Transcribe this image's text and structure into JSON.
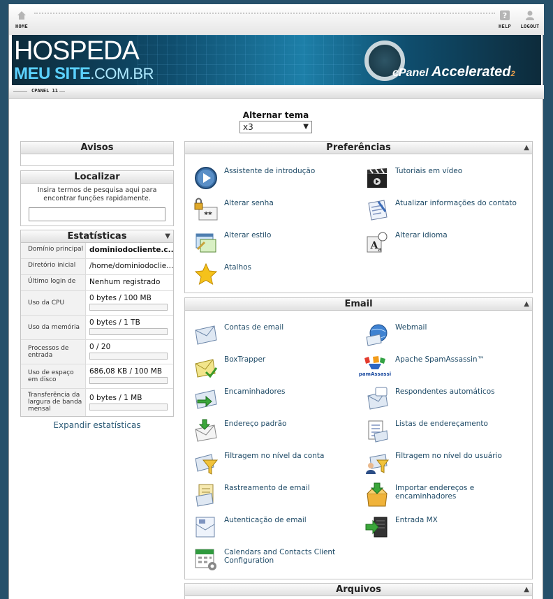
{
  "topbar": {
    "home": "HOME",
    "help": "HELP",
    "logout": "LOGOUT"
  },
  "banner": {
    "line1": "HOSPEDA",
    "line2a": "MEU SITE",
    "line2b": ".COM.BR",
    "brand": "cPanel",
    "brand_suffix": "Accelerated",
    "brand_version": "2"
  },
  "breadcrumb": "CPANEL 11",
  "theme": {
    "label": "Alternar tema",
    "selected": "x3"
  },
  "avisos": {
    "title": "Avisos"
  },
  "localizar": {
    "title": "Localizar",
    "description": "Insira termos de pesquisa aqui para encontrar funções rapidamente.",
    "value": ""
  },
  "stats": {
    "title": "Estatísticas",
    "rows": [
      {
        "label": "Domínio principal",
        "value": "dominiodocliente.c..."
      },
      {
        "label": "Diretório inicial",
        "value": "/home/dominiodoclie..."
      },
      {
        "label": "Último login de",
        "value": "Nenhum registrado"
      },
      {
        "label": "Uso da CPU",
        "value": "0 bytes / 100 MB",
        "fill": 0
      },
      {
        "label": "Uso da memória",
        "value": "0 bytes / 1 TB",
        "fill": 0
      },
      {
        "label": "Processos de entrada",
        "value": "0 / 20",
        "fill": 0
      },
      {
        "label": "Uso de espaço em disco",
        "value": "686,08 KB / 100 MB",
        "fill": 0
      },
      {
        "label": "Transferência da largura de banda mensal",
        "value": "0 bytes / 1 MB",
        "fill": 0
      }
    ],
    "expand": "Expandir estatísticas"
  },
  "preferencias": {
    "title": "Preferências",
    "items": [
      "Assistente de introdução",
      "Tutoriais em vídeo",
      "Alterar senha",
      "Atualizar informações do contato",
      "Alterar estilo",
      "Alterar idioma",
      "Atalhos"
    ]
  },
  "email": {
    "title": "Email",
    "items": [
      "Contas de email",
      "Webmail",
      "BoxTrapper",
      "Apache SpamAssassin™",
      "Encaminhadores",
      "Respondentes automáticos",
      "Endereço padrão",
      "Listas de endereçamento",
      "Filtragem no nível da conta",
      "Filtragem no nível do usuário",
      "Rastreamento de email",
      "Importar endereços e encaminhadores",
      "Autenticação de email",
      "Entrada MX",
      "Calendars and Contacts Client Configuration"
    ],
    "spamassassin_logo": "SpamAssassin"
  },
  "arquivos": {
    "title": "Arquivos"
  },
  "colors": {
    "link": "#1e4a66",
    "banner_accent": "#5bd1ff",
    "page_bg": "#26506a"
  }
}
